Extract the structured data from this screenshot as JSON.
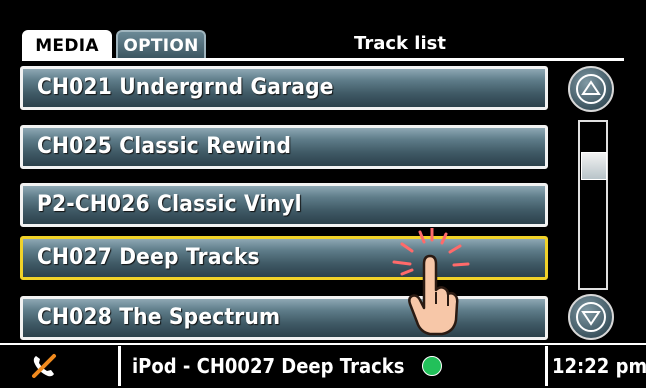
{
  "header": {
    "tabs": [
      {
        "label": "MEDIA",
        "active": true
      },
      {
        "label": "OPTION",
        "active": false
      }
    ],
    "title": "Track list"
  },
  "track_list": {
    "items": [
      {
        "label": "CH021  Undergrnd Garage",
        "selected": false
      },
      {
        "label": "CH025  Classic Rewind",
        "selected": false
      },
      {
        "label": "P2-CH026  Classic Vinyl",
        "selected": false
      },
      {
        "label": "CH027  Deep Tracks",
        "selected": true
      },
      {
        "label": "CH028  The Spectrum",
        "selected": false
      }
    ]
  },
  "scrollbar": {
    "up_icon": "triangle-up-icon",
    "down_icon": "triangle-down-icon",
    "position_fraction": 0.22
  },
  "status_bar": {
    "left_icon": "phone-mute-icon",
    "now_playing": "iPod - CH0027  Deep Tracks",
    "status_color": "#22c05a",
    "clock": "12:22 pm"
  },
  "colors": {
    "selected_border": "#f1d229",
    "row_border": "#f2f2f2"
  }
}
